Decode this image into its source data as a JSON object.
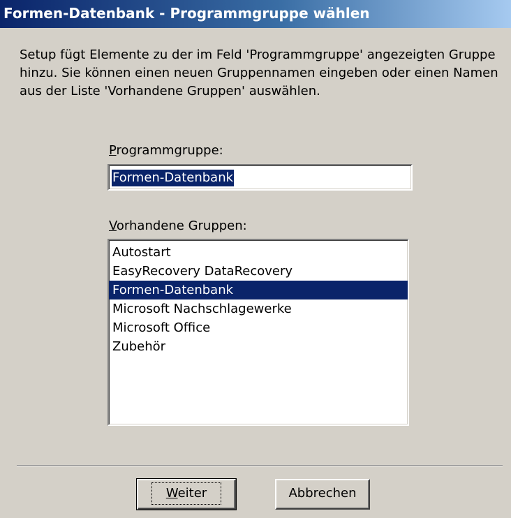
{
  "window": {
    "title": "Formen-Datenbank - Programmgruppe wählen"
  },
  "description": "Setup fügt Elemente zu der im Feld 'Programmgruppe' angezeigten Gruppe hinzu. Sie können einen neuen Gruppennamen eingeben oder einen Namen aus der Liste 'Vorhandene Gruppen' auswählen.",
  "program_group": {
    "label_mnemonic": "P",
    "label_rest": "rogrammgruppe:",
    "value": "Formen-Datenbank"
  },
  "existing_groups": {
    "label_mnemonic": "V",
    "label_rest": "orhandene Gruppen:",
    "items": [
      {
        "label": "Autostart",
        "selected": false
      },
      {
        "label": "EasyRecovery DataRecovery",
        "selected": false
      },
      {
        "label": "Formen-Datenbank",
        "selected": true
      },
      {
        "label": "Microsoft Nachschlagewerke",
        "selected": false
      },
      {
        "label": "Microsoft Office",
        "selected": false
      },
      {
        "label": "Zubehör",
        "selected": false
      }
    ]
  },
  "buttons": {
    "next_mnemonic": "W",
    "next_rest": "eiter",
    "cancel_label": "Abbrechen"
  },
  "colors": {
    "dialog_background": "#d4d0c8",
    "title_active": "#0a246a",
    "selection": "#0a246a"
  }
}
